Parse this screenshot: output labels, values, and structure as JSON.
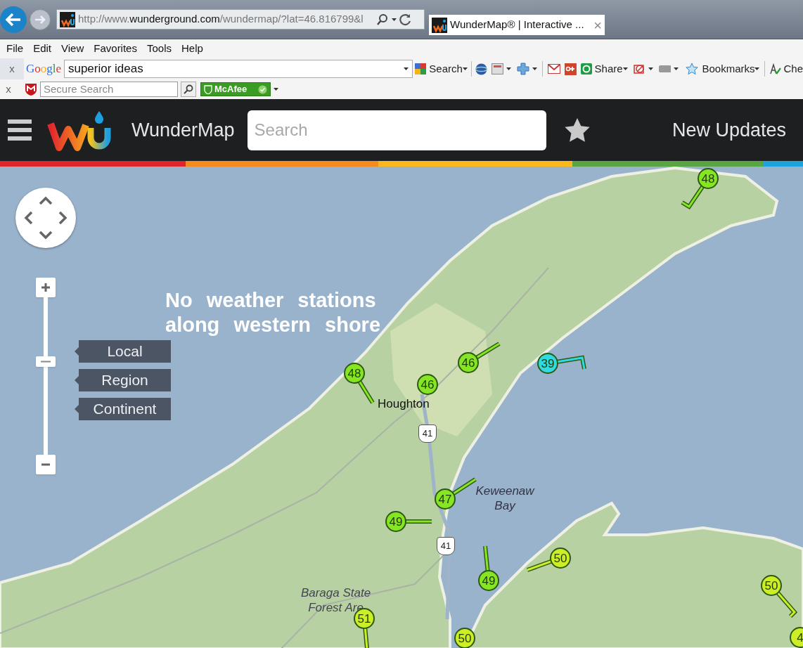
{
  "browser": {
    "url_prefix": "http://www.",
    "url_domain": "wunderground.com",
    "url_path": "/wundermap/?lat=46.816799&l",
    "tab": {
      "title": "WunderMap® | Interactive ...",
      "close": "×"
    }
  },
  "menu_bar": [
    "File",
    "Edit",
    "View",
    "Favorites",
    "Tools",
    "Help"
  ],
  "google_toolbar": {
    "close": "x",
    "logo": "Google",
    "query": "superior ideas",
    "search": "Search",
    "share": "Share",
    "bookmarks": "Bookmarks",
    "cut_item": "Che"
  },
  "mcafee_toolbar": {
    "close": "x",
    "placeholder": "Secure Search",
    "badge": "McAfee"
  },
  "site_header": {
    "title": "WunderMap",
    "search_placeholder": "Search",
    "updates": "New Updates"
  },
  "map": {
    "zoom": {
      "level": 0.59,
      "presets": [
        "Local",
        "Region",
        "Continent"
      ]
    },
    "annotation": [
      "No weather stations",
      "along western shore"
    ],
    "places": [
      {
        "kind": "town",
        "name": "Houghton"
      },
      {
        "kind": "water",
        "name": "Keweenaw Bay"
      },
      {
        "kind": "forest",
        "name": "Baraga State Forest Are"
      },
      {
        "kind": "route",
        "name": "41"
      },
      {
        "kind": "route",
        "name": "41"
      }
    ],
    "stations": [
      {
        "reading": "48",
        "color": "#86e623"
      },
      {
        "reading": "48",
        "color": "#86e623"
      },
      {
        "reading": "46",
        "color": "#86e623"
      },
      {
        "reading": "46",
        "color": "#86e623"
      },
      {
        "reading": "39",
        "color": "#2fdbe0"
      },
      {
        "reading": "47",
        "color": "#86e623"
      },
      {
        "reading": "49",
        "color": "#86e623"
      },
      {
        "reading": "49",
        "color": "#86e623"
      },
      {
        "reading": "50",
        "color": "#cdee26"
      },
      {
        "reading": "50",
        "color": "#cdee26"
      },
      {
        "reading": "51",
        "color": "#cdee26"
      },
      {
        "reading": "50",
        "color": "#cdee26"
      },
      {
        "reading": "4",
        "color": "#cdee26"
      }
    ]
  }
}
